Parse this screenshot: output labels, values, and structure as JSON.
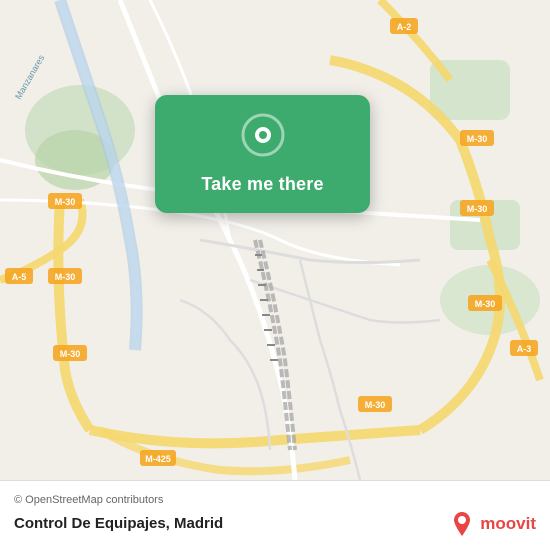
{
  "map": {
    "alt": "Map of Madrid"
  },
  "card": {
    "button_label": "Take me there",
    "pin_icon": "location-pin"
  },
  "bottom_bar": {
    "copyright": "© OpenStreetMap contributors",
    "location_name": "Control De Equipajes,",
    "city": "Madrid",
    "logo_text": "moovit"
  }
}
